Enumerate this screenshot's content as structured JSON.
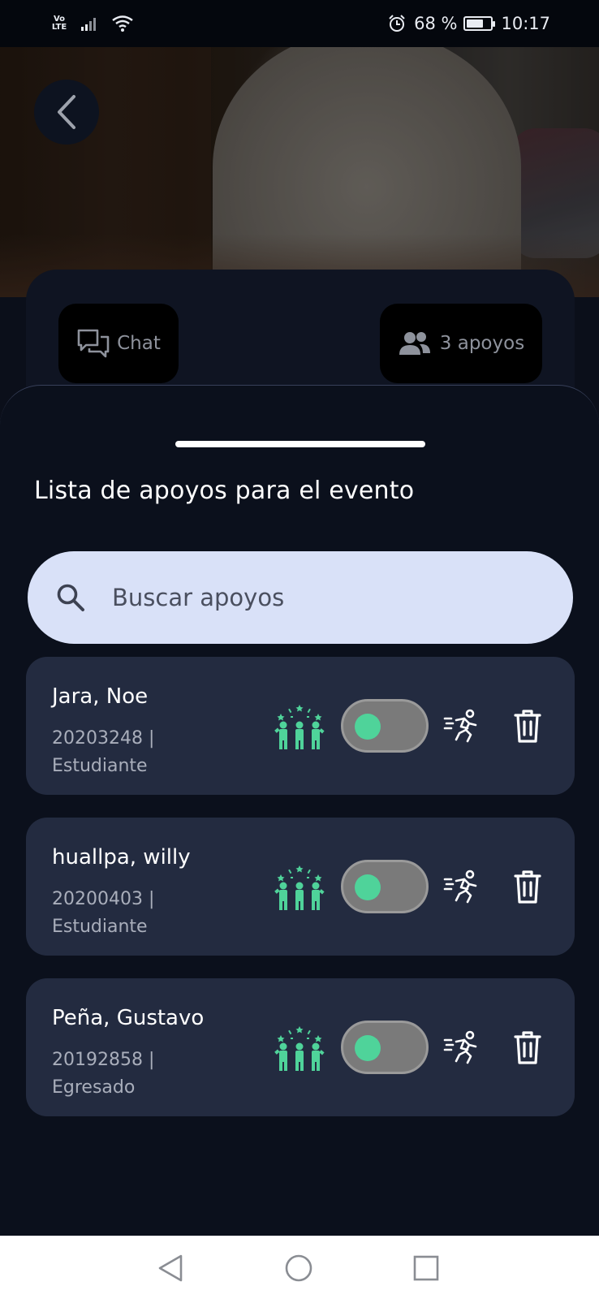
{
  "status_bar": {
    "network_type": "Vo\nLTE",
    "battery_percent_label": "68 %",
    "battery_level": 0.68,
    "time": "10:17"
  },
  "header": {
    "back_icon": "chevron-left-icon"
  },
  "event_card": {
    "chat_label": "Chat",
    "supports_label": "3 apoyos"
  },
  "sheet": {
    "title": "Lista de apoyos para el evento",
    "search": {
      "placeholder": "Buscar apoyos",
      "value": ""
    },
    "items": [
      {
        "name": "Jara, Noe",
        "code": "20203248 |",
        "role": "Estudiante",
        "toggle_on": true
      },
      {
        "name": "huallpa, willy",
        "code": "20200403 |",
        "role": "Estudiante",
        "toggle_on": true
      },
      {
        "name": "Peña, Gustavo",
        "code": "20192858 |",
        "role": "Egresado",
        "toggle_on": true
      }
    ]
  },
  "colors": {
    "accent_green": "#4fd39a",
    "sheet_background": "#0b101c",
    "card_background": "#232b40",
    "search_background": "#d9e1f8"
  }
}
